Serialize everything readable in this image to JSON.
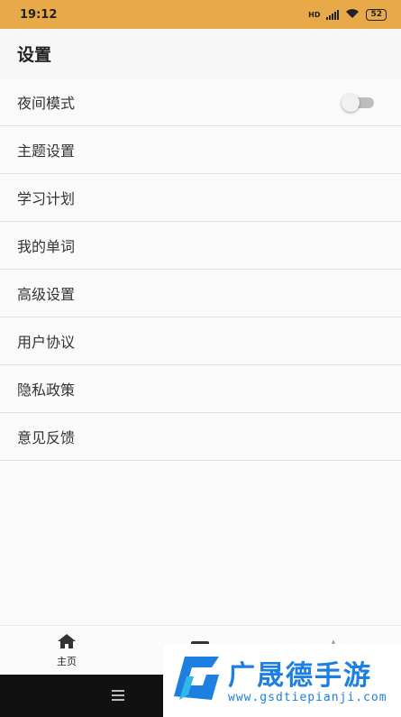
{
  "status_bar": {
    "time": "19:12",
    "network": "HD",
    "battery": "52"
  },
  "header": {
    "title": "设置"
  },
  "settings": {
    "items": [
      {
        "label": "夜间模式",
        "toggle": false
      },
      {
        "label": "主题设置"
      },
      {
        "label": "学习计划"
      },
      {
        "label": "我的单词"
      },
      {
        "label": "高级设置"
      },
      {
        "label": "用户协议"
      },
      {
        "label": "隐私政策"
      },
      {
        "label": "意见反馈"
      }
    ]
  },
  "bottom_nav": {
    "items": [
      {
        "label": "主页",
        "icon": "home-icon"
      },
      {
        "icon": "edit-icon"
      },
      {
        "icon": "star-icon"
      }
    ]
  },
  "watermark": {
    "title": "广晟德手游",
    "url": "www.gsdtiepianji.com"
  },
  "colors": {
    "status_bar": "#e8a948",
    "accent": "#1d7fe0"
  }
}
